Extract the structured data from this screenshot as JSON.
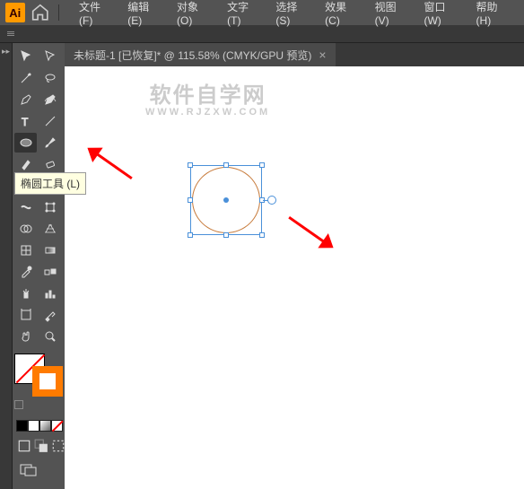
{
  "app": {
    "logo": "Ai"
  },
  "menu": [
    "文件(F)",
    "编辑(E)",
    "对象(O)",
    "文字(T)",
    "选择(S)",
    "效果(C)",
    "视图(V)",
    "窗口(W)",
    "帮助(H)"
  ],
  "tab": {
    "title": "未标题-1 [已恢复]* @ 115.58% (CMYK/GPU 预览)",
    "close": "×"
  },
  "tooltip": "椭圆工具 (L)",
  "watermark": {
    "line1": "软件自学网",
    "line2": "WWW.RJZXW.COM"
  },
  "palette": [
    "#000000",
    "#ffffff",
    "#808080",
    "#ff0000"
  ],
  "swatch": {
    "fill": "none",
    "stroke": "#ff7b00"
  }
}
